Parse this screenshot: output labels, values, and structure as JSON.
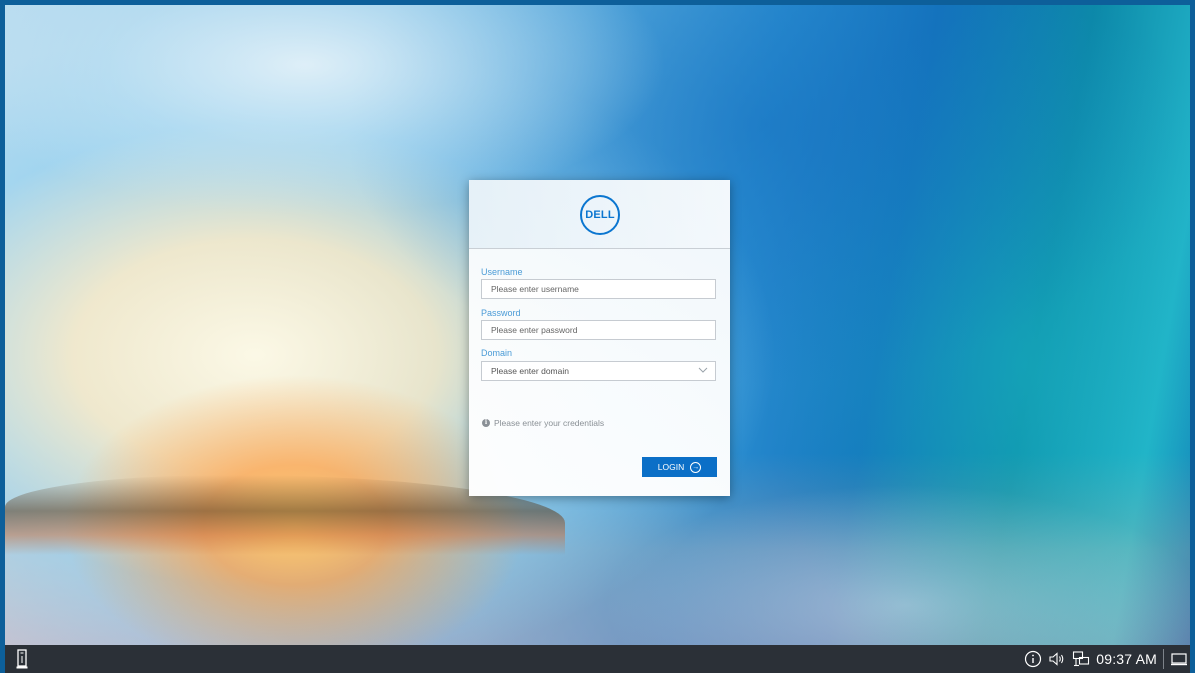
{
  "login": {
    "logo_text": "DELL",
    "username": {
      "label": "Username",
      "placeholder": "Please enter username",
      "value": ""
    },
    "password": {
      "label": "Password",
      "placeholder": "Please enter password",
      "value": ""
    },
    "domain": {
      "label": "Domain",
      "placeholder": "Please enter domain",
      "value": ""
    },
    "hint": "Please enter your credentials",
    "login_label": "LOGIN"
  },
  "taskbar": {
    "start_icon": "thin-client-icon",
    "tray_icons": [
      "info-icon",
      "volume-icon",
      "network-icon",
      "show-desktop-icon"
    ],
    "clock": "09:37 AM"
  },
  "colors": {
    "accent": "#0b6fc7",
    "label_blue": "#4a9bd6",
    "taskbar": "#2b3037"
  }
}
